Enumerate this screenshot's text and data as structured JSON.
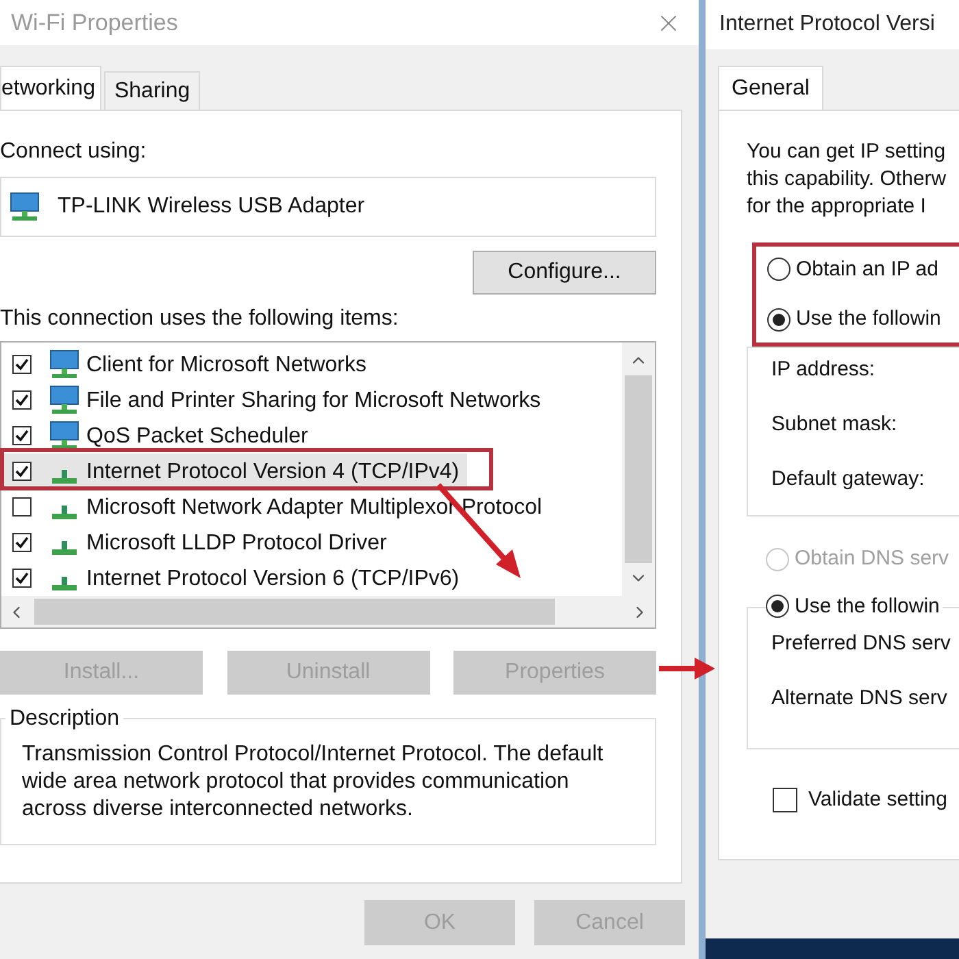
{
  "left_window": {
    "title": "Wi-Fi Properties",
    "tabs": [
      {
        "label": "etworking",
        "selected": true
      },
      {
        "label": "Sharing",
        "selected": false
      }
    ],
    "connect_label": "Connect using:",
    "adapter": "TP-LINK Wireless USB Adapter",
    "configure_button": "Configure...",
    "items_label": "This connection uses the following items:",
    "items": [
      {
        "label": "Client for Microsoft Networks",
        "checked": true,
        "kind": "client",
        "selected": false
      },
      {
        "label": "File and Printer Sharing for Microsoft Networks",
        "checked": true,
        "kind": "service",
        "selected": false
      },
      {
        "label": "QoS Packet Scheduler",
        "checked": true,
        "kind": "service",
        "selected": false
      },
      {
        "label": "Internet Protocol Version 4 (TCP/IPv4)",
        "checked": true,
        "kind": "protocol",
        "selected": true
      },
      {
        "label": "Microsoft Network Adapter Multiplexor Protocol",
        "checked": false,
        "kind": "protocol",
        "selected": false
      },
      {
        "label": "Microsoft LLDP Protocol Driver",
        "checked": true,
        "kind": "protocol",
        "selected": false
      },
      {
        "label": "Internet Protocol Version 6 (TCP/IPv6)",
        "checked": true,
        "kind": "protocol",
        "selected": false
      }
    ],
    "buttons": [
      {
        "label": "Install...",
        "disabled": true
      },
      {
        "label": "Uninstall",
        "disabled": true
      },
      {
        "label": "Properties",
        "disabled": true
      }
    ],
    "description_title": "Description",
    "description": "Transmission Control Protocol/Internet Protocol. The default wide area network protocol that provides communication across diverse interconnected networks.",
    "footer_buttons": [
      {
        "label": "OK",
        "disabled": true
      },
      {
        "label": "Cancel",
        "disabled": true
      }
    ]
  },
  "right_window": {
    "title": "Internet Protocol Versi",
    "tabs": [
      {
        "label": "General",
        "selected": true
      }
    ],
    "intro_lines": [
      "You can get IP setting",
      "this capability. Otherw",
      "for the appropriate I"
    ],
    "ip_options": [
      {
        "label": "Obtain an IP ad",
        "selected": false
      },
      {
        "label": "Use the followin",
        "selected": true
      }
    ],
    "ip_fields": [
      "IP address:",
      "Subnet mask:",
      "Default gateway:"
    ],
    "dns_options": [
      {
        "label": "Obtain DNS serv",
        "selected": false,
        "disabled": true
      },
      {
        "label": "Use the followin",
        "selected": true,
        "disabled": false
      }
    ],
    "dns_fields": [
      "Preferred DNS serv",
      "Alternate DNS serv"
    ],
    "validate": {
      "label": "Validate setting",
      "checked": false
    }
  }
}
